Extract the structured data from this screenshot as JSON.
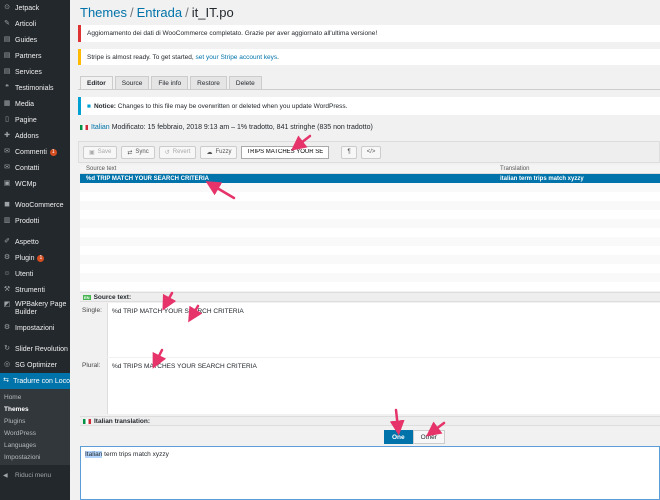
{
  "sidebar": {
    "items": [
      {
        "name": "jetpack",
        "label": "Jetpack",
        "icon": "⊙"
      },
      {
        "name": "articoli",
        "label": "Articoli",
        "icon": "✎"
      },
      {
        "name": "guides",
        "label": "Guides",
        "icon": "▤"
      },
      {
        "name": "partners",
        "label": "Partners",
        "icon": "▤"
      },
      {
        "name": "services",
        "label": "Services",
        "icon": "▤"
      },
      {
        "name": "testimonials",
        "label": "Testimonials",
        "icon": "❝"
      },
      {
        "name": "media",
        "label": "Media",
        "icon": "▦"
      },
      {
        "name": "pagine",
        "label": "Pagine",
        "icon": "▯"
      },
      {
        "name": "addons",
        "label": "Addons",
        "icon": "✚"
      },
      {
        "name": "commenti",
        "label": "Commenti",
        "icon": "✉",
        "badge": "1"
      },
      {
        "name": "contatti",
        "label": "Contatti",
        "icon": "✉"
      },
      {
        "name": "wcmp",
        "label": "WCMp",
        "icon": "▣"
      },
      {
        "sep": true
      },
      {
        "name": "woocommerce",
        "label": "WooCommerce",
        "icon": "◼"
      },
      {
        "name": "prodotti",
        "label": "Prodotti",
        "icon": "▥"
      },
      {
        "sep": true
      },
      {
        "name": "aspetto",
        "label": "Aspetto",
        "icon": "✐"
      },
      {
        "name": "plugin",
        "label": "Plugin",
        "icon": "⚙",
        "badge": "1"
      },
      {
        "name": "utenti",
        "label": "Utenti",
        "icon": "☺"
      },
      {
        "name": "strumenti",
        "label": "Strumenti",
        "icon": "⚒"
      },
      {
        "name": "wpbakery",
        "label": "WPBakery Page Builder",
        "icon": "◩",
        "multi": true
      },
      {
        "name": "impostazioni",
        "label": "Impostazioni",
        "icon": "⚙"
      },
      {
        "sep": true
      },
      {
        "name": "slider-revolution",
        "label": "Slider Revolution",
        "icon": "↻"
      },
      {
        "name": "sg-optimizer",
        "label": "SG Optimizer",
        "icon": "◎"
      },
      {
        "name": "tradurre",
        "label": "Tradurre con Loco",
        "icon": "⇆",
        "active": true
      }
    ],
    "submenu": [
      {
        "label": "Home",
        "current": false
      },
      {
        "label": "Themes",
        "current": true
      },
      {
        "label": "Plugins",
        "current": false
      },
      {
        "label": "WordPress",
        "current": false
      },
      {
        "label": "Languages",
        "current": false
      },
      {
        "label": "Impostazioni",
        "current": false
      }
    ],
    "collapse_label": "Riduci menu",
    "collapse_icon": "◀"
  },
  "header": {
    "crumb1": "Themes",
    "crumb2": "Entrada",
    "current": "it_IT.po",
    "separator": "/"
  },
  "notices": {
    "woo": "Aggiornamento dei dati di WooCommerce completato. Grazie per aver aggiornato all'ultima versione!",
    "stripe_text": "Stripe is almost ready. To get started,",
    "stripe_link": "set your Stripe account keys",
    "stripe_end": ".",
    "warn_strong": "Notice:",
    "warn_text": "Changes to this file may be overwritten or deleted when you update WordPress."
  },
  "tabs": [
    {
      "label": "Editor",
      "active": true
    },
    {
      "label": "Source",
      "active": false
    },
    {
      "label": "File info",
      "active": false
    },
    {
      "label": "Restore",
      "active": false
    },
    {
      "label": "Delete",
      "active": false
    }
  ],
  "status": {
    "language": "Italian",
    "text": "Modificato: 15 febbraio, 2018 9:13 am – 1% tradotto, 841 stringhe (835 non tradotto)"
  },
  "toolbar": {
    "save": "Save",
    "sync": "Sync",
    "revert": "Revert",
    "fuzzy": "Fuzzy",
    "search_value": "TRIPS MATCHES YOUR SE",
    "pilcrow": "¶",
    "code": "</>"
  },
  "table": {
    "col_source": "Source text",
    "col_translation": "Translation",
    "rows": [
      {
        "source": "%d TRIP MATCH YOUR SEARCH CRITERIA",
        "translation": "italian term trips match xyzzy"
      }
    ]
  },
  "source_panel": {
    "title": "Source text:",
    "tag": "EN",
    "single_label": "Single:",
    "single_value": "%d TRIP MATCH YOUR SEARCH CRITERIA",
    "plural_label": "Plural:",
    "plural_value": "%d TRIPS MATCHES YOUR SEARCH CRITERIA"
  },
  "translation_panel": {
    "title": "Italian translation:",
    "tab_one": "One",
    "tab_other": "Other",
    "value_highlight": "Italian",
    "value_rest": " term trips match xyzzy"
  },
  "colors": {
    "accent": "#0073aa",
    "sidebar": "#23282d",
    "arrow": "#e6336a"
  }
}
